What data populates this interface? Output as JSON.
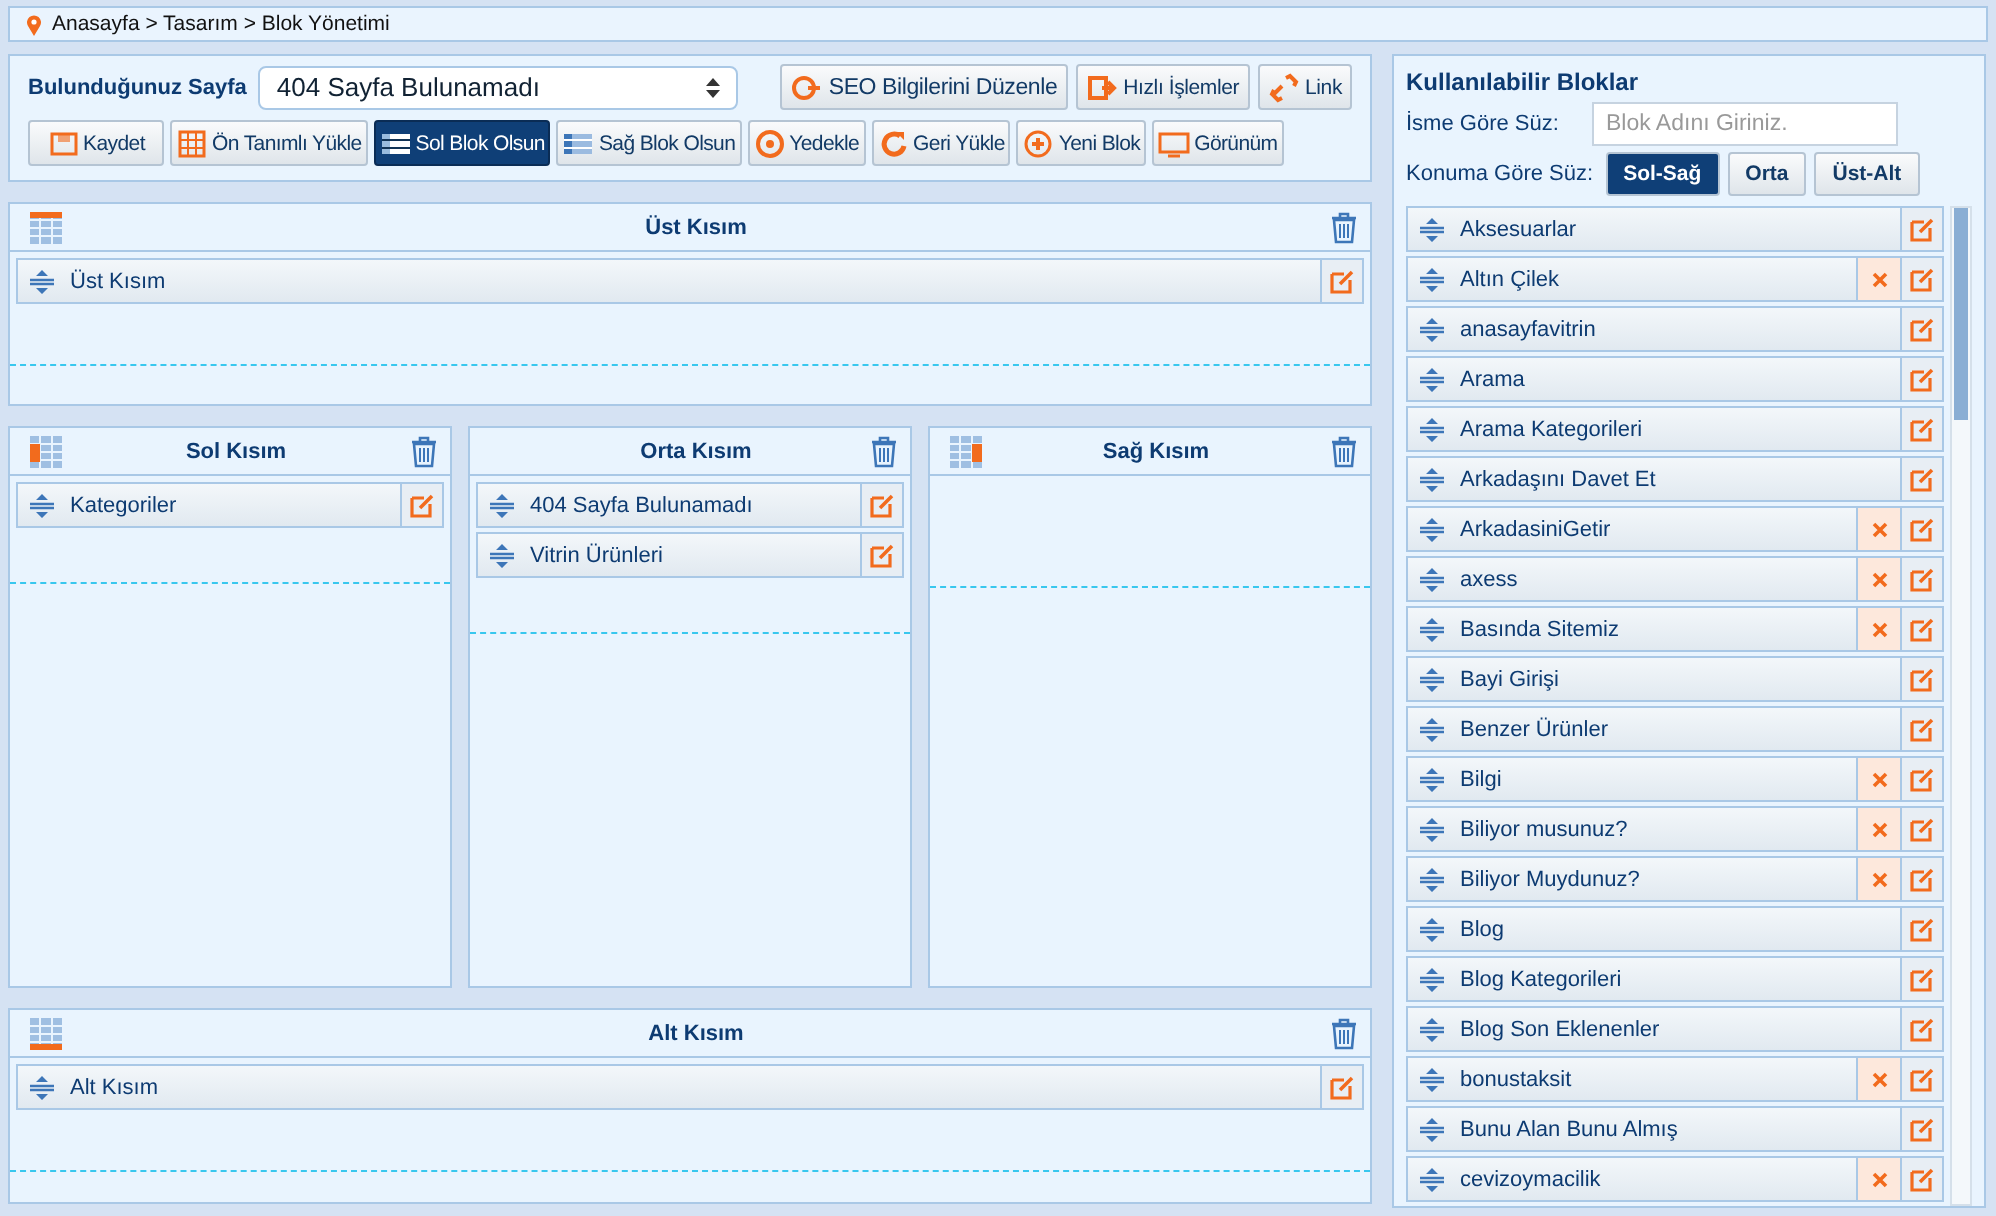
{
  "breadcrumb": "Anasayfa > Tasarım > Blok Yönetimi",
  "page_select": {
    "label": "Bulunduğunuz Sayfa",
    "value": "404 Sayfa Bulunamadı"
  },
  "top_buttons": [
    {
      "label": "SEO Bilgilerini Düzenle",
      "selected": false
    },
    {
      "label": "Hızlı İşlemler",
      "selected": false
    },
    {
      "label": "Link",
      "selected": false
    }
  ],
  "toolbar": [
    {
      "label": "Kaydet",
      "selected": false
    },
    {
      "label": "Ön Tanımlı Yükle",
      "selected": false
    },
    {
      "label": "Sol Blok Olsun",
      "selected": true
    },
    {
      "label": "Sağ Blok Olsun",
      "selected": false
    },
    {
      "label": "Yedekle",
      "selected": false
    },
    {
      "label": "Geri Yükle",
      "selected": false
    },
    {
      "label": "Yeni Blok",
      "selected": false
    },
    {
      "label": "Görünüm",
      "selected": false
    }
  ],
  "sections": [
    {
      "title": "Üst Kısım",
      "kind": "top",
      "blocks": [
        "Üst Kısım"
      ]
    },
    {
      "title": "Sol Kısım",
      "kind": "left",
      "blocks": [
        "Kategoriler"
      ]
    },
    {
      "title": "Orta Kısım",
      "kind": "center",
      "blocks": [
        "404 Sayfa Bulunamadı",
        "Vitrin Ürünleri"
      ]
    },
    {
      "title": "Sağ Kısım",
      "kind": "right"
    },
    {
      "title": "Alt Kısım",
      "kind": "bottom",
      "blocks": [
        "Alt Kısım"
      ]
    }
  ],
  "available": {
    "title": "Kullanılabilir Bloklar",
    "name_filter": {
      "label": "İsme Göre Süz:",
      "placeholder": "Blok Adını Giriniz."
    },
    "location_filter": {
      "label": "Konuma Göre Süz:",
      "options": [
        {
          "label": "Sol-Sağ",
          "selected": true
        },
        {
          "label": "Orta",
          "selected": false
        },
        {
          "label": "Üst-Alt",
          "selected": false
        }
      ]
    },
    "items": [
      {
        "name": "Aksesuarlar",
        "removable": false
      },
      {
        "name": "Altın Çilek",
        "removable": true
      },
      {
        "name": "anasayfavitrin",
        "removable": false
      },
      {
        "name": "Arama",
        "removable": false
      },
      {
        "name": "Arama Kategorileri",
        "removable": false
      },
      {
        "name": "Arkadaşını Davet Et",
        "removable": false
      },
      {
        "name": "ArkadasiniGetir",
        "removable": true
      },
      {
        "name": "axess",
        "removable": true
      },
      {
        "name": "Basında Sitemiz",
        "removable": true
      },
      {
        "name": "Bayi Girişi",
        "removable": false
      },
      {
        "name": "Benzer Ürünler",
        "removable": false
      },
      {
        "name": "Bilgi",
        "removable": true
      },
      {
        "name": "Biliyor musunuz?",
        "removable": true
      },
      {
        "name": "Biliyor Muydunuz?",
        "removable": true
      },
      {
        "name": "Blog",
        "removable": false
      },
      {
        "name": "Blog Kategorileri",
        "removable": false
      },
      {
        "name": "Blog Son Eklenenler",
        "removable": false
      },
      {
        "name": "bonustaksit",
        "removable": true
      },
      {
        "name": "Bunu Alan Bunu Almış",
        "removable": false
      },
      {
        "name": "cevizoymacilik",
        "removable": true
      }
    ]
  }
}
